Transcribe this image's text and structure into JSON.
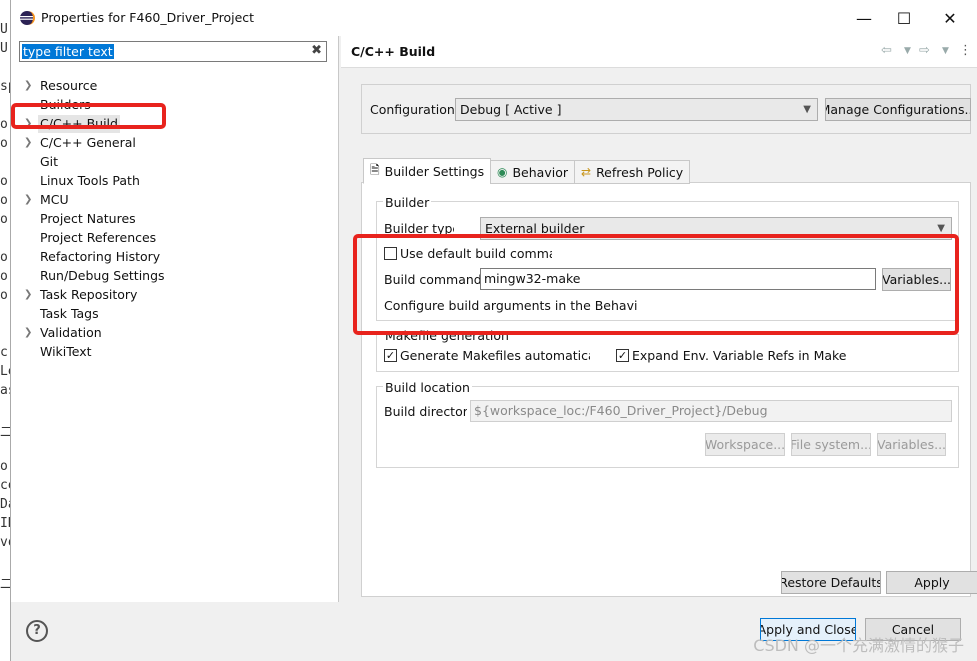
{
  "background_code_strip": [
    "U",
    "U",
    "",
    "sp",
    "",
    "o",
    "o",
    "",
    "o",
    "o",
    "o",
    "",
    "o",
    "o",
    "o",
    "",
    "",
    "c",
    "Le",
    "as",
    "",
    "二",
    "",
    "o",
    "ce",
    "Da",
    "IN",
    "vo",
    "",
    "二"
  ],
  "window": {
    "title": "Properties for F460_Driver_Project",
    "minimize": "—",
    "maximize": "☐",
    "close": "✕"
  },
  "filter": {
    "value": "type filter text",
    "clear": "✖"
  },
  "tree": [
    {
      "label": "Resource",
      "expandable": true
    },
    {
      "label": "Builders",
      "expandable": false
    },
    {
      "label": "C/C++ Build",
      "expandable": true,
      "selected": true
    },
    {
      "label": "C/C++ General",
      "expandable": true
    },
    {
      "label": "Git",
      "expandable": false
    },
    {
      "label": "Linux Tools Path",
      "expandable": false
    },
    {
      "label": "MCU",
      "expandable": true
    },
    {
      "label": "Project Natures",
      "expandable": false
    },
    {
      "label": "Project References",
      "expandable": false
    },
    {
      "label": "Refactoring History",
      "expandable": false
    },
    {
      "label": "Run/Debug Settings",
      "expandable": false
    },
    {
      "label": "Task Repository",
      "expandable": true
    },
    {
      "label": "Task Tags",
      "expandable": false
    },
    {
      "label": "Validation",
      "expandable": true
    },
    {
      "label": "WikiText",
      "expandable": false
    }
  ],
  "page": {
    "title": "C/C++ Build",
    "configuration_label": "Configuration",
    "configuration_value": "Debug  [ Active ]",
    "manage_button": "Manage Configurations...",
    "tabs": [
      {
        "label": "Builder Settings",
        "icon": "document-icon"
      },
      {
        "label": "Behavior",
        "icon": "radio-icon"
      },
      {
        "label": "Refresh Policy",
        "icon": "refresh-icon"
      }
    ],
    "builder": {
      "group_label": "Builder",
      "type_label": "Builder type",
      "type_value": "External builder",
      "use_default_label": "Use default build comman",
      "use_default_checked": false,
      "command_label": "Build command",
      "command_value": "mingw32-make",
      "variables_button": "Variables...",
      "configure_note": "Configure build arguments in the Behavior '"
    },
    "makefile": {
      "group_label": "Makefile generation",
      "generate_label": "Generate Makefiles automaticall",
      "generate_checked": true,
      "expand_label": "Expand Env. Variable Refs in Makefil",
      "expand_checked": true
    },
    "location": {
      "group_label": "Build location",
      "dir_label": "Build director",
      "dir_value": "${workspace_loc:/F460_Driver_Project}/Debug",
      "workspace_button": "Workspace...",
      "filesystem_button": "File system...",
      "variables_button": "Variables..."
    },
    "restore_button": "Restore Defaults",
    "apply_button": "Apply"
  },
  "footer": {
    "help": "?",
    "apply_close_button": "Apply and Close",
    "cancel_button": "Cancel",
    "watermark": "CSDN @一个充满激情的猴子"
  },
  "colors": {
    "highlight_box": "#e8231d",
    "selection": "#0078d7"
  }
}
